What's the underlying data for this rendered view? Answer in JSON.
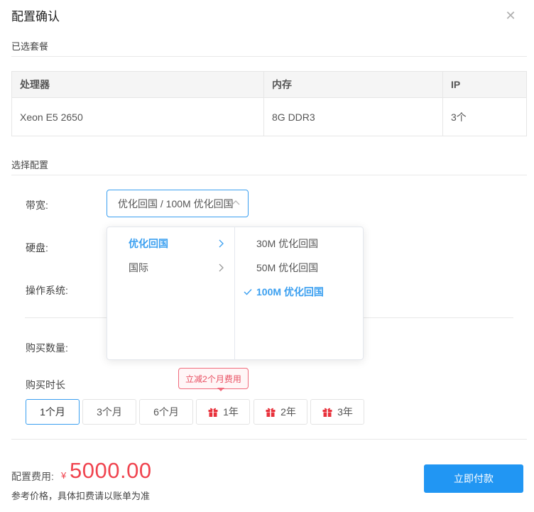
{
  "dialog": {
    "title": "配置确认",
    "close_icon": "close-icon"
  },
  "selected_package": {
    "section_label": "已选套餐",
    "columns": [
      "处理器",
      "内存",
      "IP"
    ],
    "row": [
      "Xeon E5 2650",
      "8G DDR3",
      "3个"
    ]
  },
  "config": {
    "section_label": "选择配置",
    "bandwidth_label": "带宽:",
    "bandwidth_value": "优化回国 / 100M 优化回国",
    "disk_label": "硬盘:",
    "os_label": "操作系统:",
    "quantity_label": "购买数量:",
    "duration_label": "购买时长"
  },
  "cascader_menu": {
    "level1": [
      {
        "label": "优化回国",
        "active": true
      },
      {
        "label": "国际",
        "active": false
      }
    ],
    "level2": [
      {
        "label": "30M 优化回国",
        "selected": false
      },
      {
        "label": "50M 优化回国",
        "selected": false
      },
      {
        "label": "100M 优化回国",
        "selected": true
      }
    ]
  },
  "promo_tooltip": "立减2个月费用",
  "durations": [
    {
      "label": "1个月",
      "gift": false,
      "selected": true
    },
    {
      "label": "3个月",
      "gift": false,
      "selected": false
    },
    {
      "label": "6个月",
      "gift": false,
      "selected": false
    },
    {
      "label": "1年",
      "gift": true,
      "selected": false
    },
    {
      "label": "2年",
      "gift": true,
      "selected": false
    },
    {
      "label": "3年",
      "gift": true,
      "selected": false
    }
  ],
  "footer": {
    "fee_label": "配置费用:",
    "currency": "¥",
    "price": "5000.00",
    "note": "参考价格，具体扣费请以账单为准",
    "pay_button": "立即付款"
  },
  "colors": {
    "accent": "#3a9ff0",
    "primary_button": "#2196f3",
    "price": "#f0444f",
    "gift": "#e8323c"
  }
}
